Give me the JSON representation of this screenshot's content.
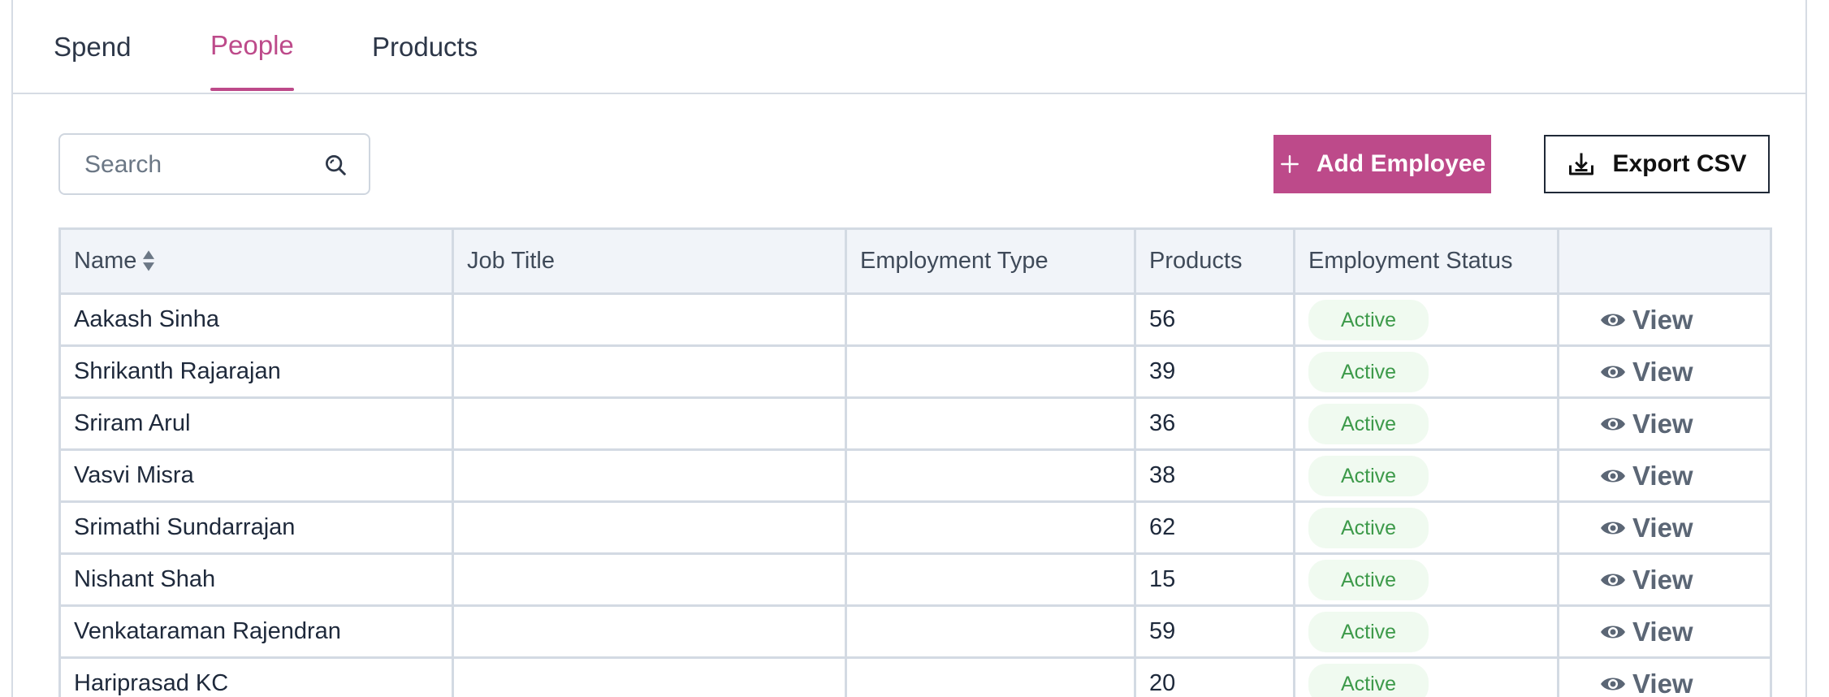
{
  "tabs": [
    {
      "label": "Spend",
      "active": false
    },
    {
      "label": "People",
      "active": true
    },
    {
      "label": "Products",
      "active": false
    }
  ],
  "search": {
    "placeholder": "Search",
    "value": ""
  },
  "toolbar": {
    "add_label": "Add Employee",
    "export_label": "Export CSV"
  },
  "table": {
    "headers": {
      "name": "Name",
      "job_title": "Job Title",
      "employment_type": "Employment Type",
      "products": "Products",
      "employment_status": "Employment Status",
      "actions": ""
    },
    "view_label": "View",
    "rows": [
      {
        "name": "Aakash Sinha",
        "job_title": "",
        "employment_type": "",
        "products": "56",
        "status": "Active"
      },
      {
        "name": "Shrikanth Rajarajan",
        "job_title": "",
        "employment_type": "",
        "products": "39",
        "status": "Active"
      },
      {
        "name": "Sriram Arul",
        "job_title": "",
        "employment_type": "",
        "products": "36",
        "status": "Active"
      },
      {
        "name": "Vasvi Misra",
        "job_title": "",
        "employment_type": "",
        "products": "38",
        "status": "Active"
      },
      {
        "name": "Srimathi Sundarrajan",
        "job_title": "",
        "employment_type": "",
        "products": "62",
        "status": "Active"
      },
      {
        "name": "Nishant Shah",
        "job_title": "",
        "employment_type": "",
        "products": "15",
        "status": "Active"
      },
      {
        "name": "Venkataraman Rajendran",
        "job_title": "",
        "employment_type": "",
        "products": "59",
        "status": "Active"
      },
      {
        "name": "Hariprasad KC",
        "job_title": "",
        "employment_type": "",
        "products": "20",
        "status": "Active"
      }
    ]
  },
  "colors": {
    "accent": "#bd4a8a",
    "status_active_text": "#3d9a4a",
    "status_active_bg": "#f0faf0"
  },
  "icons": {
    "search": "search-icon",
    "add": "plus-icon",
    "export": "download-icon",
    "sort": "sort-icon",
    "view": "eye-icon"
  }
}
